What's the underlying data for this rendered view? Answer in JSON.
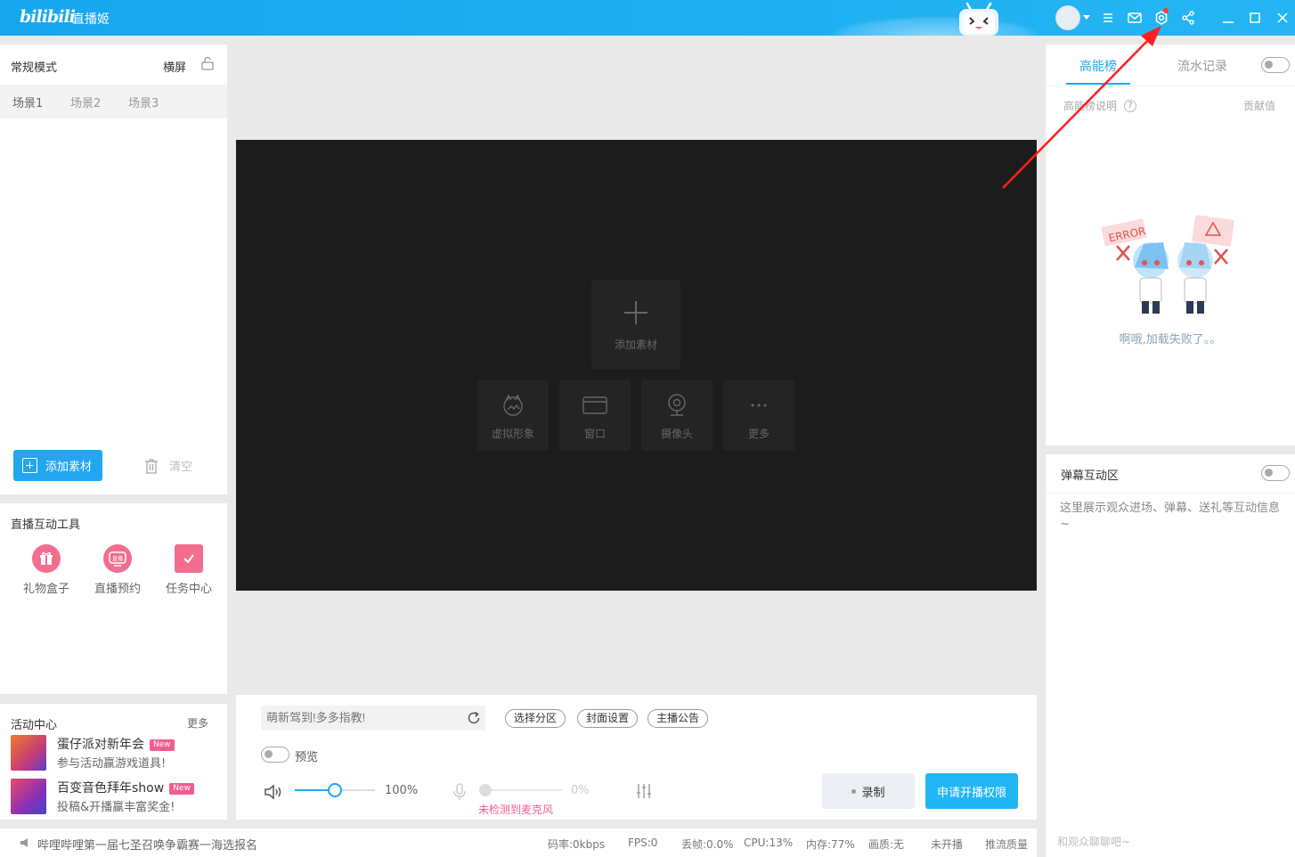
{
  "titlebar": {
    "logo": "bilibili",
    "app_name": "直播姬"
  },
  "scene_panel": {
    "mode": "常规模式",
    "orientation": "横屏",
    "scenes": [
      "场景1",
      "场景2",
      "场景3"
    ],
    "add_source_label": "添加素材",
    "clear_label": "清空"
  },
  "tools": {
    "title": "直播互动工具",
    "items": [
      {
        "label": "礼物盒子",
        "icon": "gift-box-icon"
      },
      {
        "label": "直播预约",
        "icon": "reservation-icon"
      },
      {
        "label": "任务中心",
        "icon": "task-center-icon"
      }
    ],
    "reservation_tag": "直播"
  },
  "activity": {
    "title": "活动中心",
    "more": "更多",
    "items": [
      {
        "name": "蛋仔派对新年会",
        "badge": "New",
        "desc": "参与活动赢游戏道具!"
      },
      {
        "name": "百变音色拜年show",
        "badge": "New",
        "desc": "投稿&开播赢丰富奖金!"
      }
    ]
  },
  "canvas": {
    "add_source": "添加素材",
    "options": [
      {
        "label": "虚拟形象",
        "icon": "virtual-avatar-icon"
      },
      {
        "label": "窗口",
        "icon": "window-icon"
      },
      {
        "label": "摄像头",
        "icon": "camera-icon"
      },
      {
        "label": "更多",
        "icon": "more-icon"
      }
    ]
  },
  "controls": {
    "title_placeholder": "萌新驾到!多多指教!",
    "pills": [
      "选择分区",
      "封面设置",
      "主播公告"
    ],
    "preview_label": "预览",
    "volume_pct": "100%",
    "volume_level": 0.5,
    "mic_pct": "0%",
    "mic_warning": "未检测到麦克风",
    "record_label": "录制",
    "apply_label": "申请开播权限"
  },
  "statusbar": {
    "notice": "哔哩哔哩第一届七圣召唤争霸赛一海选报名",
    "stats": [
      "码率:0kbps",
      "FPS:0",
      "丢帧:0.0%",
      "CPU:13%",
      "内存:77%",
      "画质:无",
      "未开播",
      "推流质量"
    ]
  },
  "rank_panel": {
    "tabs": [
      "高能榜",
      "流水记录"
    ],
    "info": "高能榜说明",
    "contrib": "贡献值",
    "error_text": "啊哦,加载失败了。。",
    "error_sign": "ERROR"
  },
  "danmaku": {
    "title": "弹幕互动区",
    "desc": "这里展示观众进场、弹幕、送礼等互动信息~",
    "input_placeholder": "和观众聊聊吧~"
  },
  "colors": {
    "accent": "#22a6f0",
    "pink": "#f25d8e",
    "canvas_bg": "#1c1c1c"
  }
}
